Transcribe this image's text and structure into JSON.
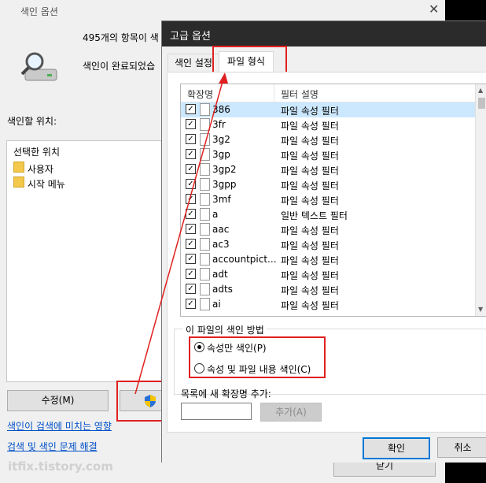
{
  "background_window": {
    "title": "색인 옵션",
    "close_glyph": "✕",
    "count_text": "495개의 항목이 색",
    "status_text": "색인이 완료되었습",
    "locations_label": "색인할 위치:",
    "locations_header": "선택한 위치",
    "locations": [
      "사용자",
      "시작 메뉴"
    ],
    "modify_button": "수정(M)",
    "advanced_button_icon": "shield-icon",
    "links": [
      "색인이 검색에 미치는 영향",
      "검색 및 색인 문제 해결"
    ],
    "close_button": "닫기",
    "watermark": "itfix.tistory.com"
  },
  "dialog": {
    "title": "고급 옵션",
    "tabs": [
      "색인 설정",
      "파일 형식"
    ],
    "active_tab": 1,
    "columns": [
      "확장명",
      "필터 설명"
    ],
    "rows": [
      {
        "ext": "386",
        "desc": "파일 속성 필터",
        "checked": true
      },
      {
        "ext": "3fr",
        "desc": "파일 속성 필터",
        "checked": true
      },
      {
        "ext": "3g2",
        "desc": "파일 속성 필터",
        "checked": true
      },
      {
        "ext": "3gp",
        "desc": "파일 속성 필터",
        "checked": true
      },
      {
        "ext": "3gp2",
        "desc": "파일 속성 필터",
        "checked": true
      },
      {
        "ext": "3gpp",
        "desc": "파일 속성 필터",
        "checked": true
      },
      {
        "ext": "3mf",
        "desc": "파일 속성 필터",
        "checked": true
      },
      {
        "ext": "a",
        "desc": "일반 텍스트 필터",
        "checked": true
      },
      {
        "ext": "aac",
        "desc": "파일 속성 필터",
        "checked": true
      },
      {
        "ext": "ac3",
        "desc": "파일 속성 필터",
        "checked": true
      },
      {
        "ext": "accountpict...",
        "desc": "파일 속성 필터",
        "checked": true
      },
      {
        "ext": "adt",
        "desc": "파일 속성 필터",
        "checked": true
      },
      {
        "ext": "adts",
        "desc": "파일 속성 필터",
        "checked": true
      },
      {
        "ext": "ai",
        "desc": "파일 속성 필터",
        "checked": true
      }
    ],
    "group_label": "이 파일의 색인 방법",
    "radio_options": [
      "속성만 색인(P)",
      "속성 및 파일 내용 색인(C)"
    ],
    "radio_selected": 0,
    "add_label": "목록에 새 확장명 추가:",
    "add_input_value": "",
    "add_button": "추가(A)",
    "ok_button": "확인",
    "cancel_button": "취소"
  },
  "colors": {
    "highlight_red": "#e02020",
    "dialog_titlebar": "#2b2b2b",
    "link_blue": "#0050c8",
    "selected_row": "#cce8ff"
  }
}
